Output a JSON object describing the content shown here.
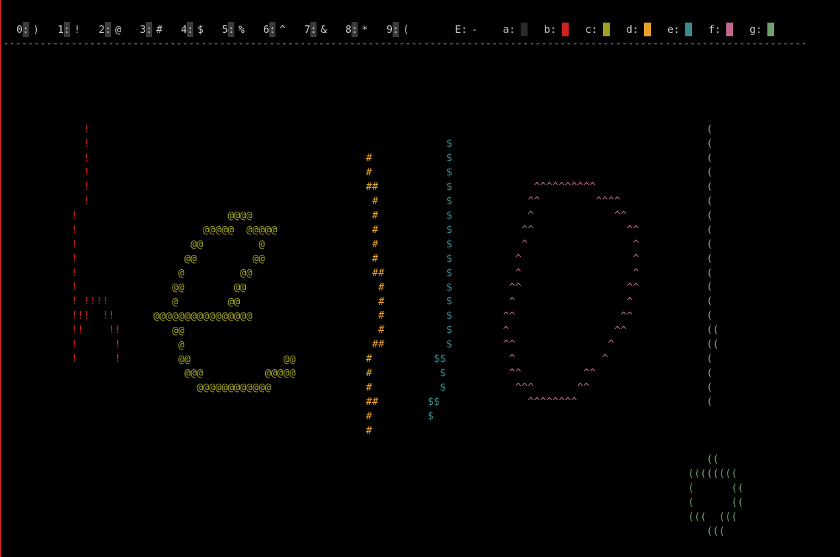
{
  "palette": {
    "digits": [
      {
        "key": "0",
        "glyph": ")"
      },
      {
        "key": "1",
        "glyph": "!"
      },
      {
        "key": "2",
        "glyph": "@"
      },
      {
        "key": "3",
        "glyph": "#"
      },
      {
        "key": "4",
        "glyph": "$"
      },
      {
        "key": "5",
        "glyph": "%"
      },
      {
        "key": "6",
        "glyph": "^"
      },
      {
        "key": "7",
        "glyph": "&"
      },
      {
        "key": "8",
        "glyph": "*"
      },
      {
        "key": "9",
        "glyph": "("
      }
    ],
    "eraser": {
      "key": "E",
      "glyph": "-"
    },
    "colors": [
      {
        "key": "a",
        "color": "#2a2a2a"
      },
      {
        "key": "b",
        "color": "#cc2222"
      },
      {
        "key": "c",
        "color": "#a0a020"
      },
      {
        "key": "d",
        "color": "#e8a028"
      },
      {
        "key": "e",
        "color": "#3a8a8a"
      },
      {
        "key": "f",
        "color": "#c06890"
      },
      {
        "key": "g",
        "color": "#70a070"
      }
    ]
  },
  "separator_char": "-",
  "drawing": {
    "letter_h": {
      "color": "#cc2222",
      "lines": [
        "  !",
        "  !",
        "  !",
        "  !",
        "  !",
        "  !",
        "!",
        "!",
        "!",
        "!",
        "!",
        "!",
        "! !!!!",
        "!!!  !!",
        "!!    !!",
        "!      !",
        "!      !"
      ]
    },
    "letter_e": {
      "color": "#a0a020",
      "lines": [
        "            @@@@",
        "        @@@@@  @@@@@",
        "      @@         @",
        "     @@         @@",
        "    @         @@",
        "   @@        @@",
        "   @        @@",
        "@@@@@@@@@@@@@@@@",
        "   @@",
        "    @",
        "    @@               @@",
        "     @@@          @@@@@",
        "       @@@@@@@@@@@@"
      ]
    },
    "letter_l1": {
      "color": "#e8a028",
      "lines": [
        "#",
        "#",
        "##",
        " #",
        " #",
        " #",
        " #",
        " #",
        " ##",
        "  #",
        "  #",
        "  #",
        "  #",
        " ##",
        "#",
        "#",
        "#",
        "##",
        "#",
        "#"
      ]
    },
    "letter_l2": {
      "color": "#3a8a8a",
      "lines": [
        "   $",
        "   $",
        "   $",
        "   $",
        "   $",
        "   $",
        "   $",
        "   $",
        "   $",
        "   $",
        "   $",
        "   $",
        "   $",
        "   $",
        "   $",
        " $$",
        "  $",
        "  $",
        "$$",
        "$"
      ]
    },
    "letter_o": {
      "color": "#c06890",
      "lines": [
        "     ^^^^^^^^^^",
        "    ^^         ^^^^",
        "    ^             ^^",
        "   ^^               ^^",
        "   ^                 ^",
        "  ^                  ^",
        "  ^                  ^",
        " ^^                 ^^",
        " ^                  ^",
        "^^                 ^^",
        "^                 ^^",
        "^^               ^",
        " ^              ^",
        " ^^          ^^",
        "  ^^^       ^^",
        "    ^^^^^^^^"
      ]
    },
    "exclamation": {
      "color": "#70a070",
      "lines": [
        "   (",
        "   (",
        "   (",
        "   (",
        "   (",
        "   (",
        "   (",
        "   (",
        "   (",
        "   (",
        "   (",
        "   (",
        "   (",
        "   (",
        "   ((",
        "   ((",
        "   (",
        "   (",
        "   (",
        "   (",
        "",
        "",
        "",
        "   ((",
        "((((((((",
        "(      ((",
        "(      ((",
        "(((  (((",
        "   ((("
      ]
    }
  }
}
